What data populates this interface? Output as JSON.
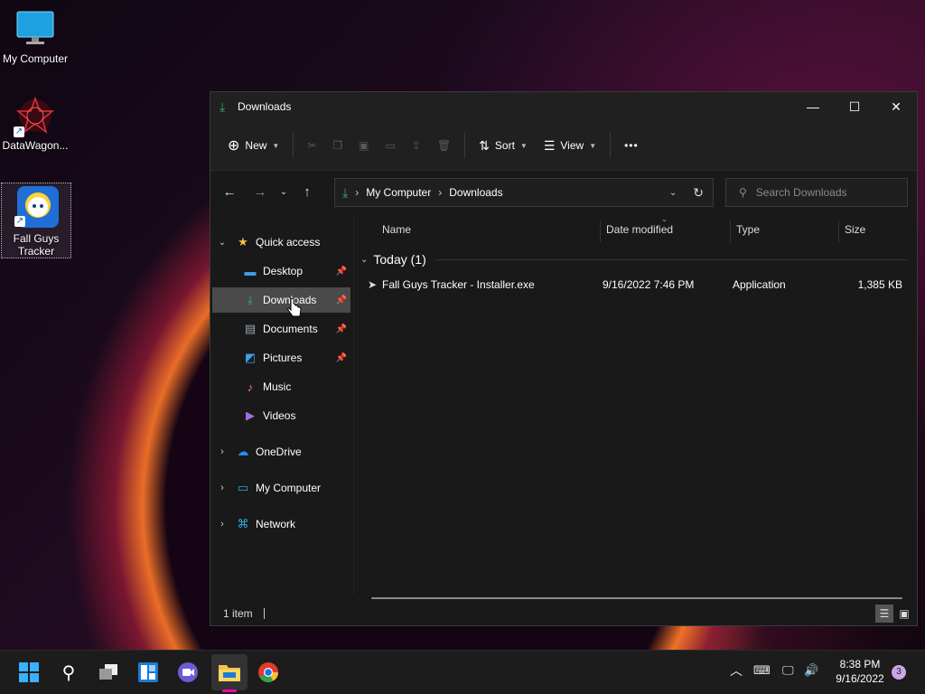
{
  "desktop": {
    "icons": [
      {
        "label": "My Computer"
      },
      {
        "label": "DataWagon..."
      },
      {
        "label": "Fall Guys Tracker"
      }
    ]
  },
  "window": {
    "title": "Downloads",
    "toolbar": {
      "new_label": "New",
      "sort_label": "Sort",
      "view_label": "View",
      "more_label": "•••"
    },
    "address": {
      "crumbs": [
        "My Computer",
        "Downloads"
      ]
    },
    "search": {
      "placeholder": "Search Downloads"
    },
    "sidebar": {
      "quick_access": "Quick access",
      "items": [
        "Desktop",
        "Downloads",
        "Documents",
        "Pictures",
        "Music",
        "Videos"
      ],
      "sections": [
        "OneDrive",
        "My Computer",
        "Network"
      ]
    },
    "columns": {
      "name": "Name",
      "date": "Date modified",
      "type": "Type",
      "size": "Size"
    },
    "group": {
      "label": "Today (1)"
    },
    "files": [
      {
        "name": "Fall Guys Tracker - Installer.exe",
        "date": "9/16/2022 7:46 PM",
        "type": "Application",
        "size": "1,385 KB"
      }
    ],
    "status": {
      "count": "1 item"
    }
  },
  "taskbar": {
    "clock": {
      "time": "8:38 PM",
      "date": "9/16/2022"
    },
    "notifications": "3"
  }
}
